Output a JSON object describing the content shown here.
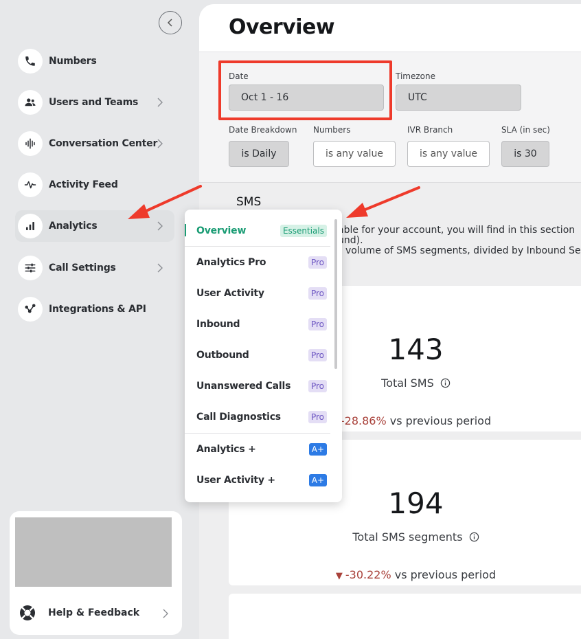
{
  "sidebar": {
    "items": [
      {
        "label": "Numbers",
        "icon": "phone-icon",
        "has_chevron": false
      },
      {
        "label": "Users and Teams",
        "icon": "users-icon",
        "has_chevron": true
      },
      {
        "label": "Conversation Center",
        "icon": "audio-wave-icon",
        "has_chevron": true
      },
      {
        "label": "Activity Feed",
        "icon": "pulse-icon",
        "has_chevron": false
      },
      {
        "label": "Analytics",
        "icon": "bar-chart-icon",
        "has_chevron": true,
        "active": true
      },
      {
        "label": "Call Settings",
        "icon": "sliders-icon",
        "has_chevron": true
      },
      {
        "label": "Integrations & API",
        "icon": "integration-icon",
        "has_chevron": false
      }
    ],
    "help_label": "Help & Feedback"
  },
  "header": {
    "title": "Overview"
  },
  "filters": {
    "date": {
      "label": "Date",
      "value": "Oct 1 - 16"
    },
    "timezone": {
      "label": "Timezone",
      "value": "UTC"
    },
    "date_breakdown": {
      "label": "Date Breakdown",
      "value": "is Daily"
    },
    "numbers": {
      "label": "Numbers",
      "value": "is any value"
    },
    "ivr_branch": {
      "label": "IVR Branch",
      "value": "is any value"
    },
    "sla": {
      "label": "SLA (in sec)",
      "value": "is 30"
    }
  },
  "sms": {
    "title": "SMS",
    "desc_line1": "able for your account, you will find in this section",
    "desc_line2": "und).",
    "desc_line3": "volume of SMS segments, divided by Inbound Se"
  },
  "metrics": [
    {
      "value": "143",
      "label": "Total SMS",
      "change": "-28.86%",
      "suffix": "vs previous period",
      "show_triangle": false
    },
    {
      "value": "194",
      "label": "Total SMS segments",
      "change": "-30.22%",
      "suffix": "vs previous period",
      "show_triangle": true
    }
  ],
  "dropdown": {
    "items": [
      {
        "label": "Overview",
        "badge": "Essentials",
        "badge_type": "ess",
        "active": true
      },
      {
        "label": "Analytics Pro",
        "badge": "Pro",
        "badge_type": "pro"
      },
      {
        "label": "User Activity",
        "badge": "Pro",
        "badge_type": "pro"
      },
      {
        "label": "Inbound",
        "badge": "Pro",
        "badge_type": "pro"
      },
      {
        "label": "Outbound",
        "badge": "Pro",
        "badge_type": "pro"
      },
      {
        "label": "Unanswered Calls",
        "badge": "Pro",
        "badge_type": "pro"
      },
      {
        "label": "Call Diagnostics",
        "badge": "Pro",
        "badge_type": "pro"
      },
      {
        "label": "Analytics +",
        "badge": "A+",
        "badge_type": "aplus"
      },
      {
        "label": "User Activity +",
        "badge": "A+",
        "badge_type": "aplus"
      }
    ]
  },
  "colors": {
    "accent": "#1a9c74",
    "highlight": "#ee3a2b",
    "negative": "#a9423b",
    "pro": "#6b54c2",
    "aplus": "#2d7be5"
  }
}
